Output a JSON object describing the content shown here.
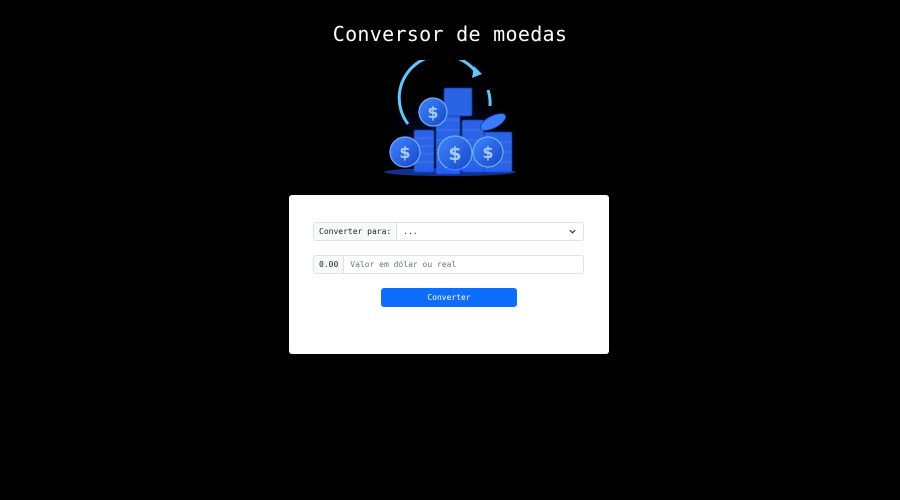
{
  "page": {
    "title": "Conversor de moedas"
  },
  "hero": {
    "icon": "coins-exchange-icon",
    "colors": {
      "coin": "#1f62e8",
      "glow": "#4cc3ff"
    }
  },
  "form": {
    "currency_label": "Converter para:",
    "currency_selected": "...",
    "amount_prefix": "0.00",
    "amount_placeholder": "Valor em dólar ou real",
    "amount_value": "",
    "submit_label": "Converter"
  },
  "colors": {
    "background": "#000000",
    "card": "#ffffff",
    "primary": "#0d6efd"
  }
}
